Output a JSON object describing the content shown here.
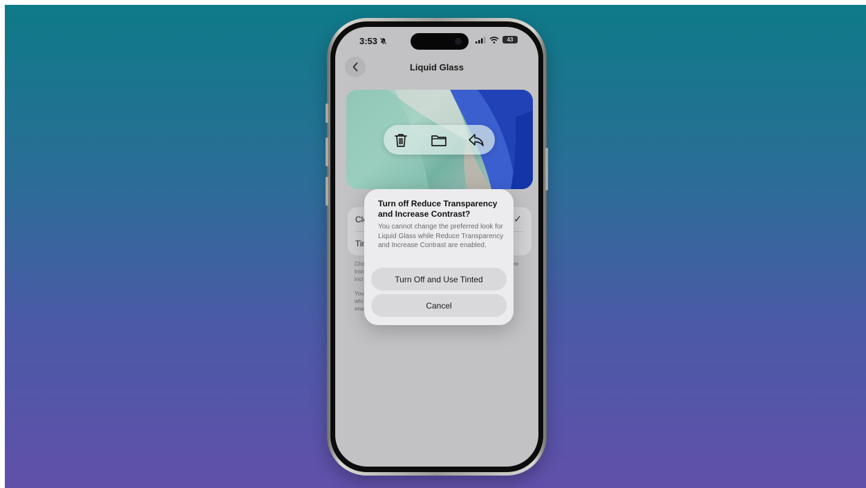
{
  "status_bar": {
    "time": "3:53",
    "battery": "43",
    "icons": [
      "bell-slash-icon",
      "cellular-signal-icon",
      "wifi-icon",
      "battery-icon"
    ]
  },
  "nav": {
    "title": "Liquid Glass",
    "back_icon": "chevron-left-icon"
  },
  "preview": {
    "toolbar_icons": [
      "trash-icon",
      "folder-icon",
      "reply-icon"
    ]
  },
  "options": {
    "items": [
      {
        "label": "Cle",
        "selected": true
      },
      {
        "label": "Tin",
        "selected": false
      }
    ],
    "check": "✓"
  },
  "footer": {
    "para1_lines": [
      "Cho",
      "tran",
      "incr"
    ],
    "para1_right_fragment": "re",
    "para2_lines": [
      "You",
      "whi",
      "ena"
    ]
  },
  "alert": {
    "title": "Turn off Reduce Transparency and Increase Contrast?",
    "message": "You cannot change the preferred look for Liquid Glass while Reduce Transparency and Increase Contrast are enabled.",
    "primary_button": "Turn Off and Use Tinted",
    "cancel_button": "Cancel"
  },
  "colors": {
    "background_top": "#0e7a88",
    "background_bottom": "#6150aa",
    "screen_dim": "#c2c2c4",
    "alert_bg": "#ececee"
  }
}
